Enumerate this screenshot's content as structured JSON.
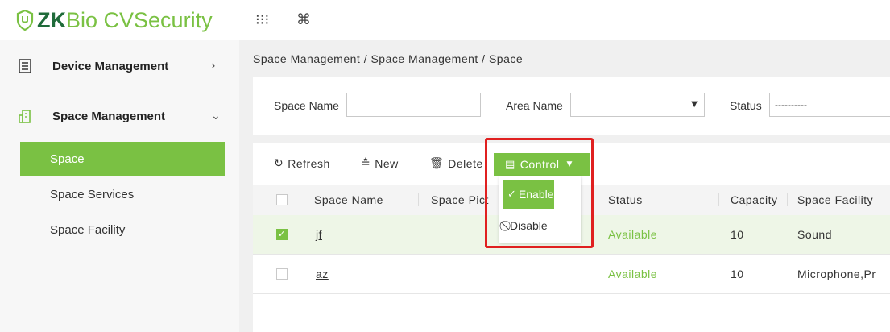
{
  "app": {
    "logo_text": "ZKBio CVSecurity",
    "logo_prefix": "ZK",
    "logo_suffix": "Bio CVSecurity"
  },
  "topbar": {
    "apps_icon": "grid-dots-icon",
    "command_icon": "command-icon"
  },
  "sidebar": {
    "groups": [
      {
        "label": "Device Management",
        "icon": "device-icon",
        "arrow": "›"
      },
      {
        "label": "Space Management",
        "icon": "building-icon",
        "arrow": "⌄"
      }
    ],
    "items": [
      {
        "label": "Space",
        "active": true
      },
      {
        "label": "Space Services",
        "active": false
      },
      {
        "label": "Space Facility",
        "active": false
      }
    ]
  },
  "breadcrumb": "Space Management / Space Management / Space",
  "filters": {
    "space_name_label": "Space Name",
    "space_name_value": "",
    "area_name_label": "Area Name",
    "area_name_value": "",
    "status_label": "Status",
    "status_value": "----------"
  },
  "toolbar": {
    "refresh": "Refresh",
    "new": "New",
    "delete": "Delete",
    "control": "Control"
  },
  "dropdown": {
    "enable": "Enable",
    "disable": "Disable"
  },
  "table": {
    "headers": [
      "Space Name",
      "Space Pict",
      "Status",
      "Capacity",
      "Space Facility"
    ],
    "rows": [
      {
        "name": "jf",
        "status": "Available",
        "capacity": "10",
        "facility": "Sound",
        "checked": true
      },
      {
        "name": "az",
        "status": "Available",
        "capacity": "10",
        "facility": "Microphone,Pr",
        "checked": false
      }
    ]
  },
  "colors": {
    "accent": "#7ac143",
    "highlight": "#e02020"
  }
}
